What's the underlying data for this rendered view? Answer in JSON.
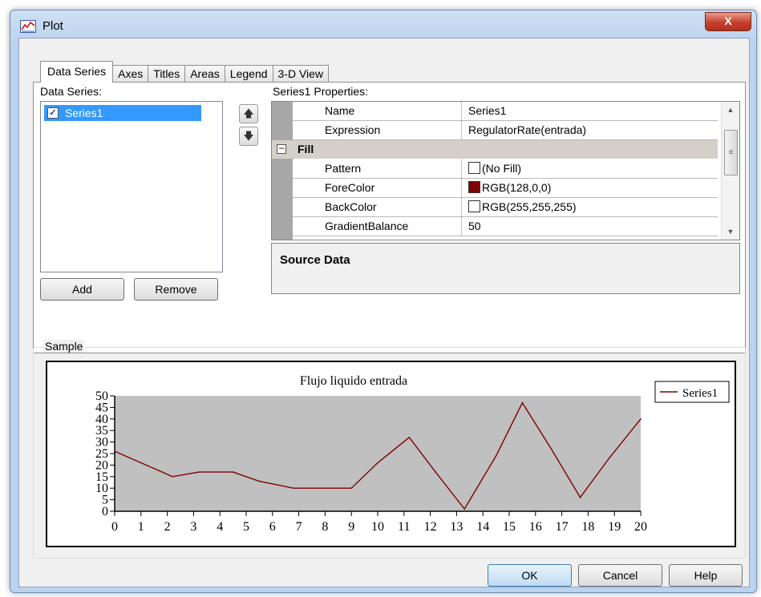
{
  "window": {
    "title": "Plot",
    "close_glyph": "X"
  },
  "tabs": [
    "Data Series",
    "Axes",
    "Titles",
    "Areas",
    "Legend",
    "3-D View"
  ],
  "series_panel": {
    "label": "Data Series:",
    "items": [
      {
        "name": "Series1",
        "checked": true
      }
    ],
    "add_label": "Add",
    "remove_label": "Remove",
    "move_up_icon": "arrow-up-icon",
    "move_down_icon": "arrow-down-icon"
  },
  "properties": {
    "label": "Series1 Properties:",
    "rows": [
      {
        "key": "Name",
        "value": "Series1"
      },
      {
        "key": "Expression",
        "value": "RegulatorRate(entrada)"
      }
    ],
    "fill_category": {
      "label": "Fill",
      "toggle": "−"
    },
    "fill_rows": [
      {
        "key": "Pattern",
        "value": "(No Fill)",
        "swatch": "#ffffff"
      },
      {
        "key": "ForeColor",
        "value": "RGB(128,0,0)",
        "swatch": "#800000"
      },
      {
        "key": "BackColor",
        "value": "RGB(255,255,255)",
        "swatch": "#ffffff"
      },
      {
        "key": "GradientBalance",
        "value": "50"
      }
    ],
    "description_title": "Source Data"
  },
  "sample": {
    "label": "Sample"
  },
  "chart_data": {
    "type": "line",
    "title": "Flujo liquido entrada",
    "x": [
      0,
      1,
      2.2,
      3.2,
      4.5,
      5.5,
      6.8,
      8,
      9,
      10,
      11.2,
      12.2,
      13.3,
      14.5,
      15.5,
      16.6,
      17.7,
      18.8,
      20
    ],
    "series": [
      {
        "name": "Series1",
        "color": "#800000",
        "values": [
          26,
          21,
          15,
          17,
          17,
          13,
          10,
          10,
          10,
          21,
          32,
          17,
          1,
          24,
          47,
          27,
          6,
          23,
          40
        ]
      }
    ],
    "xlim": [
      0,
      20
    ],
    "ylim": [
      0,
      50
    ],
    "xticks": [
      0,
      1,
      2,
      3,
      4,
      5,
      6,
      7,
      8,
      9,
      10,
      11,
      12,
      13,
      14,
      15,
      16,
      17,
      18,
      19,
      20
    ],
    "yticks": [
      0,
      5,
      10,
      15,
      20,
      25,
      30,
      35,
      40,
      45,
      50
    ],
    "plot_background": "#c0c0c0",
    "legend_position": "top-right"
  },
  "buttons": {
    "ok": "OK",
    "cancel": "Cancel",
    "help": "Help"
  }
}
